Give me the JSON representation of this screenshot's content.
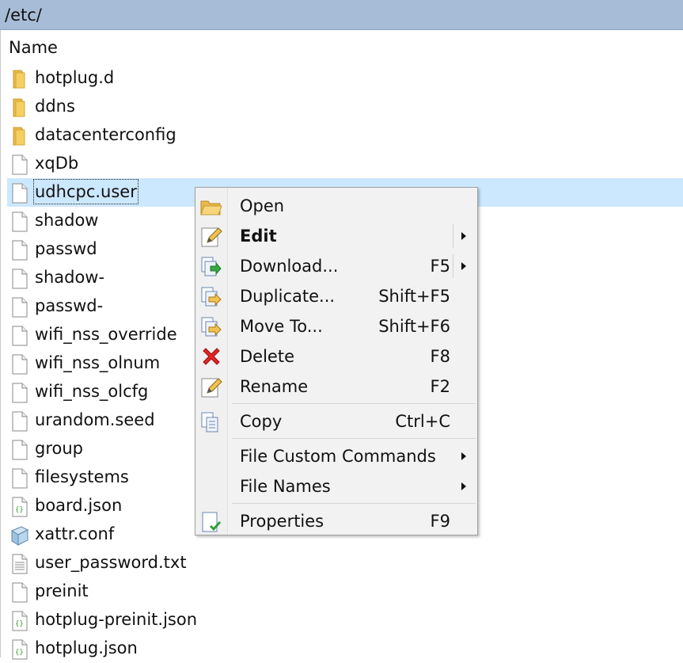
{
  "path": "/etc/",
  "columns": {
    "name": "Name"
  },
  "files": [
    {
      "name": "hotplug.d",
      "icon": "folder-icon",
      "type": "folder"
    },
    {
      "name": "ddns",
      "icon": "folder-icon",
      "type": "folder"
    },
    {
      "name": "datacenterconfig",
      "icon": "folder-icon",
      "type": "folder"
    },
    {
      "name": "xqDb",
      "icon": "file-icon",
      "type": "file"
    },
    {
      "name": "udhcpc.user",
      "icon": "file-icon",
      "type": "file",
      "selected": true
    },
    {
      "name": "shadow",
      "icon": "file-icon",
      "type": "file"
    },
    {
      "name": "passwd",
      "icon": "file-icon",
      "type": "file"
    },
    {
      "name": "shadow-",
      "icon": "file-icon",
      "type": "file"
    },
    {
      "name": "passwd-",
      "icon": "file-icon",
      "type": "file"
    },
    {
      "name": "wifi_nss_override",
      "icon": "file-icon",
      "type": "file"
    },
    {
      "name": "wifi_nss_olnum",
      "icon": "file-icon",
      "type": "file"
    },
    {
      "name": "wifi_nss_olcfg",
      "icon": "file-icon",
      "type": "file"
    },
    {
      "name": "urandom.seed",
      "icon": "file-icon",
      "type": "file"
    },
    {
      "name": "group",
      "icon": "file-icon",
      "type": "file"
    },
    {
      "name": "filesystems",
      "icon": "file-icon",
      "type": "file"
    },
    {
      "name": "board.json",
      "icon": "json-file-icon",
      "type": "json"
    },
    {
      "name": "xattr.conf",
      "icon": "conf-file-icon",
      "type": "conf"
    },
    {
      "name": "user_password.txt",
      "icon": "text-file-icon",
      "type": "text"
    },
    {
      "name": "preinit",
      "icon": "file-icon",
      "type": "file"
    },
    {
      "name": "hotplug-preinit.json",
      "icon": "json-file-icon",
      "type": "json"
    },
    {
      "name": "hotplug.json",
      "icon": "json-file-icon",
      "type": "json"
    }
  ],
  "context_menu": {
    "items": [
      {
        "label": "Open",
        "shortcut": "",
        "icon": "open-folder-icon"
      },
      {
        "label": "Edit",
        "shortcut": "",
        "icon": "edit-pencil-icon",
        "submenu": true
      },
      {
        "label": "Download...",
        "shortcut": "F5",
        "icon": "download-icon",
        "submenu": true
      },
      {
        "label": "Duplicate...",
        "shortcut": "Shift+F5",
        "icon": "duplicate-icon"
      },
      {
        "label": "Move To...",
        "shortcut": "Shift+F6",
        "icon": "move-icon"
      },
      {
        "label": "Delete",
        "shortcut": "F8",
        "icon": "delete-x-icon"
      },
      {
        "label": "Rename",
        "shortcut": "F2",
        "icon": "rename-icon"
      },
      {
        "label": "Copy",
        "shortcut": "Ctrl+C",
        "icon": "copy-icon"
      },
      {
        "label": "File Custom Commands",
        "shortcut": "",
        "submenu": true
      },
      {
        "label": "File Names",
        "shortcut": "",
        "submenu": true
      },
      {
        "label": "Properties",
        "shortcut": "F9",
        "icon": "properties-icon"
      }
    ]
  }
}
